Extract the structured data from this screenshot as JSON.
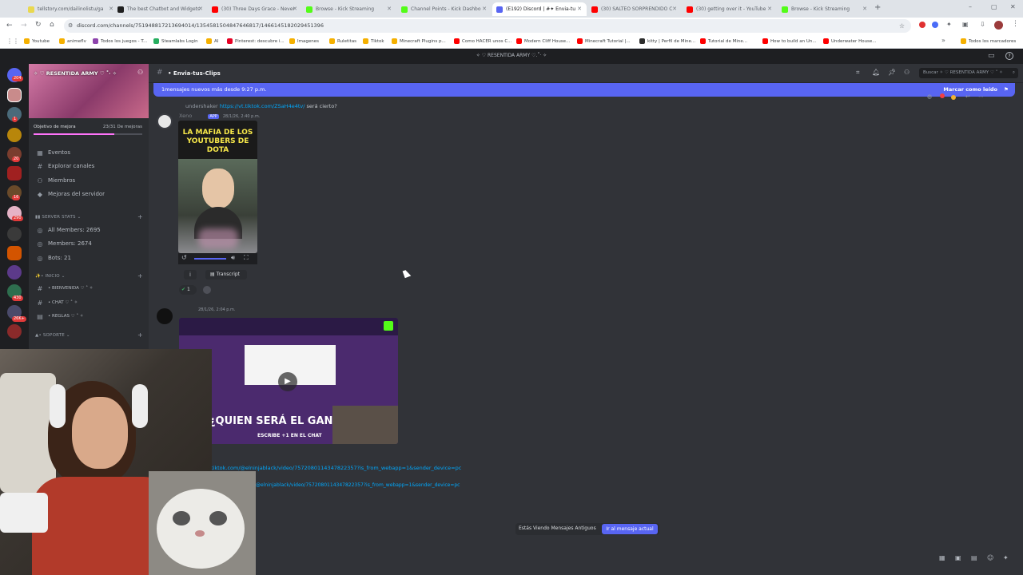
{
  "browser": {
    "tabs": [
      {
        "label": "tellstory.com/dailinolistu/ga",
        "fav_color": "#e9d84f"
      },
      {
        "label": "The best Chatbot and Widgets",
        "fav_color": "#1f1f1f"
      },
      {
        "label": "(30) Three Days Grace - Never",
        "fav_color": "#ff0000"
      },
      {
        "label": "Browse - Kick Streaming",
        "fav_color": "#53fc18"
      },
      {
        "label": "Channel Points - Kick Dashbo",
        "fav_color": "#53fc18"
      },
      {
        "label": "(E192) Discord | #✦ Envia-tu",
        "fav_color": "#5865f2"
      },
      {
        "label": "(30) SALTEO SORPRENDIDO C",
        "fav_color": "#ff0000"
      },
      {
        "label": "(30) getting over it - YouTube",
        "fav_color": "#ff0000"
      },
      {
        "label": "Browse - Kick Streaming",
        "fav_color": "#53fc18"
      }
    ],
    "url": "discord.com/channels/751948817213694014/1354581504847646817/1466145182029451396",
    "bookmarks": [
      "Youtube",
      "animeflv",
      "Todos los juegos - T...",
      "Steamlabs Login",
      "AI",
      "Pinterest: descubre i...",
      "Imagenes",
      "Ruletitas",
      "Tiktok",
      "Minecraft Plugins p...",
      "Como HACER unos C...",
      "Modern Cliff House...",
      "Minecraft Tutorial |...",
      "kitty | Perfil de Mine...",
      "Tutorial de Mine...",
      "How to build an Un...",
      "Underwater House..."
    ],
    "all_bookmarks": "Todos los marcadores"
  },
  "discord": {
    "title": "✧ ♡ RESENTIDA ARMY ♡.˚‧ ✧",
    "server_name": "✧ ♡ RESENTIDA ARMY ♡ ˚‧ ✧",
    "boost_goal": {
      "label": "Objetivo de mejora",
      "value": "23/31 De mejoras"
    },
    "menu": [
      "Eventos",
      "Explorar canales",
      "Miembros",
      "Mejoras del servidor"
    ],
    "stats_category": "SERVER STATS",
    "stats": [
      "All Members: 2695",
      "Members: 2674",
      "Bots: 21"
    ],
    "inicio_category": "• INICIO",
    "inicio_channels": [
      "• BIENVENIDA ♡ ˚ ✧",
      "• CHAT ♡ ˚ ✧",
      "• REGLAS ♡ ˚ ✧"
    ],
    "soporte_category": "• SOPORTE",
    "channel_name": "• Envia-tus-Clips",
    "search_placeholder": "Buscar ✧ ♡ RESENTIDA ARMY ♡ ˚ ✧",
    "new_messages": "1mensajes nuevos más desde 9:27 p.m.",
    "mark_read": "Marcar como leído",
    "server_badges": [
      "204",
      "1",
      "20",
      "16",
      "290",
      "430",
      "26K+"
    ],
    "message1": {
      "reply_user": "undershaker",
      "reply_link": "https://vt.tiktok.com/ZSaH4e4tv/",
      "reply_text": "será cierto?",
      "author": "Xeno",
      "app_tag": "APP",
      "time": "28/1/26, 2:40 p.m.",
      "thumb_title": "LA MAFIA DE LOS YOUTUBERS DE DOTA",
      "transcript": "Transcript",
      "reaction_count": "1"
    },
    "message2": {
      "time": "28/1/26, 2:04 p.m.",
      "video_banner": "¿QUIEN SERÁ EL GAN",
      "video_sub": "ESCRIBE +1 EN EL CHAT",
      "link1": "tiktok.com/@elninjablack/video/7572080114347822357?is_from_webapp=1&sender_device=pc",
      "link2": "@elninjablack/video/7572080114347822357?is_from_webapp=1&sender_device=pc"
    },
    "jump_label": "Estás Viendo Mensajes Antiguos",
    "jump_button": "Ir al mensaje actual"
  }
}
